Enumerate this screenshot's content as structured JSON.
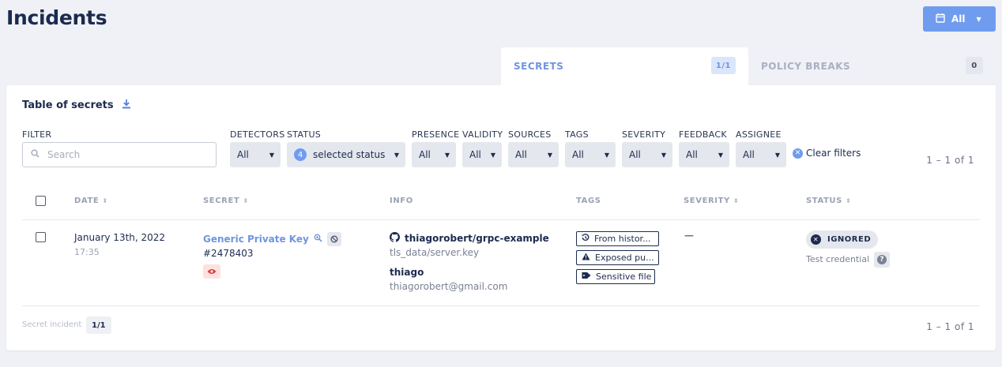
{
  "page": {
    "title": "Incidents"
  },
  "date_filter": {
    "label": "All"
  },
  "tabs": [
    {
      "label": "SECRETS",
      "count": "1/1",
      "active": true
    },
    {
      "label": "POLICY BREAKS",
      "count": "0",
      "active": false
    }
  ],
  "table": {
    "title": "Table of secrets",
    "filters": {
      "filter_label": "FILTER",
      "search_placeholder": "Search",
      "detectors": {
        "label": "DETECTORS",
        "value": "All"
      },
      "status": {
        "label": "STATUS",
        "count": "4",
        "value": "selected status"
      },
      "presence": {
        "label": "PRESENCE",
        "value": "All"
      },
      "validity": {
        "label": "VALIDITY",
        "value": "All"
      },
      "sources": {
        "label": "SOURCES",
        "value": "All"
      },
      "tags": {
        "label": "TAGS",
        "value": "All"
      },
      "severity": {
        "label": "SEVERITY",
        "value": "All"
      },
      "feedback": {
        "label": "FEEDBACK",
        "value": "All"
      },
      "assignee": {
        "label": "ASSIGNEE",
        "value": "All"
      },
      "clear_label": "Clear filters"
    },
    "pagination_top": "1 – 1  of  1",
    "columns": {
      "date": "DATE",
      "secret": "SECRET",
      "info": "INFO",
      "tags": "TAGS",
      "severity": "SEVERITY",
      "status": "STATUS"
    },
    "rows": [
      {
        "date": "January 13th, 2022",
        "time": "17:35",
        "secret_name": "Generic Private Key",
        "secret_id": "#2478403",
        "repo": "thiagorobert/grpc-example",
        "file": "tls_data/server.key",
        "author_name": "thiago",
        "author_email": "thiagorobert@gmail.com",
        "tags": [
          "From histor...",
          "Exposed pu...",
          "Sensitive file"
        ],
        "severity": "—",
        "status": "IGNORED",
        "status_reason": "Test credential"
      }
    ],
    "footer": {
      "label": "Secret incident",
      "count": "1/1",
      "pagination": "1 – 1  of  1"
    }
  },
  "colors": {
    "accent": "#6f9cef",
    "link": "#6f95e0",
    "navy": "#1d2b4f",
    "danger_bg": "#fde1e1",
    "danger": "#d93c3c"
  },
  "icons": {
    "date_button": "calendar-icon",
    "download": "download-icon",
    "search": "search-icon",
    "zoom": "zoom-icon",
    "ban": "ban-icon",
    "eye": "eye-icon",
    "repo": "github-icon",
    "tag_history": "history-icon",
    "tag_exposed": "warning-icon",
    "tag_sensitive": "tag-icon",
    "status": "x-circle-icon",
    "help": "question-icon"
  }
}
